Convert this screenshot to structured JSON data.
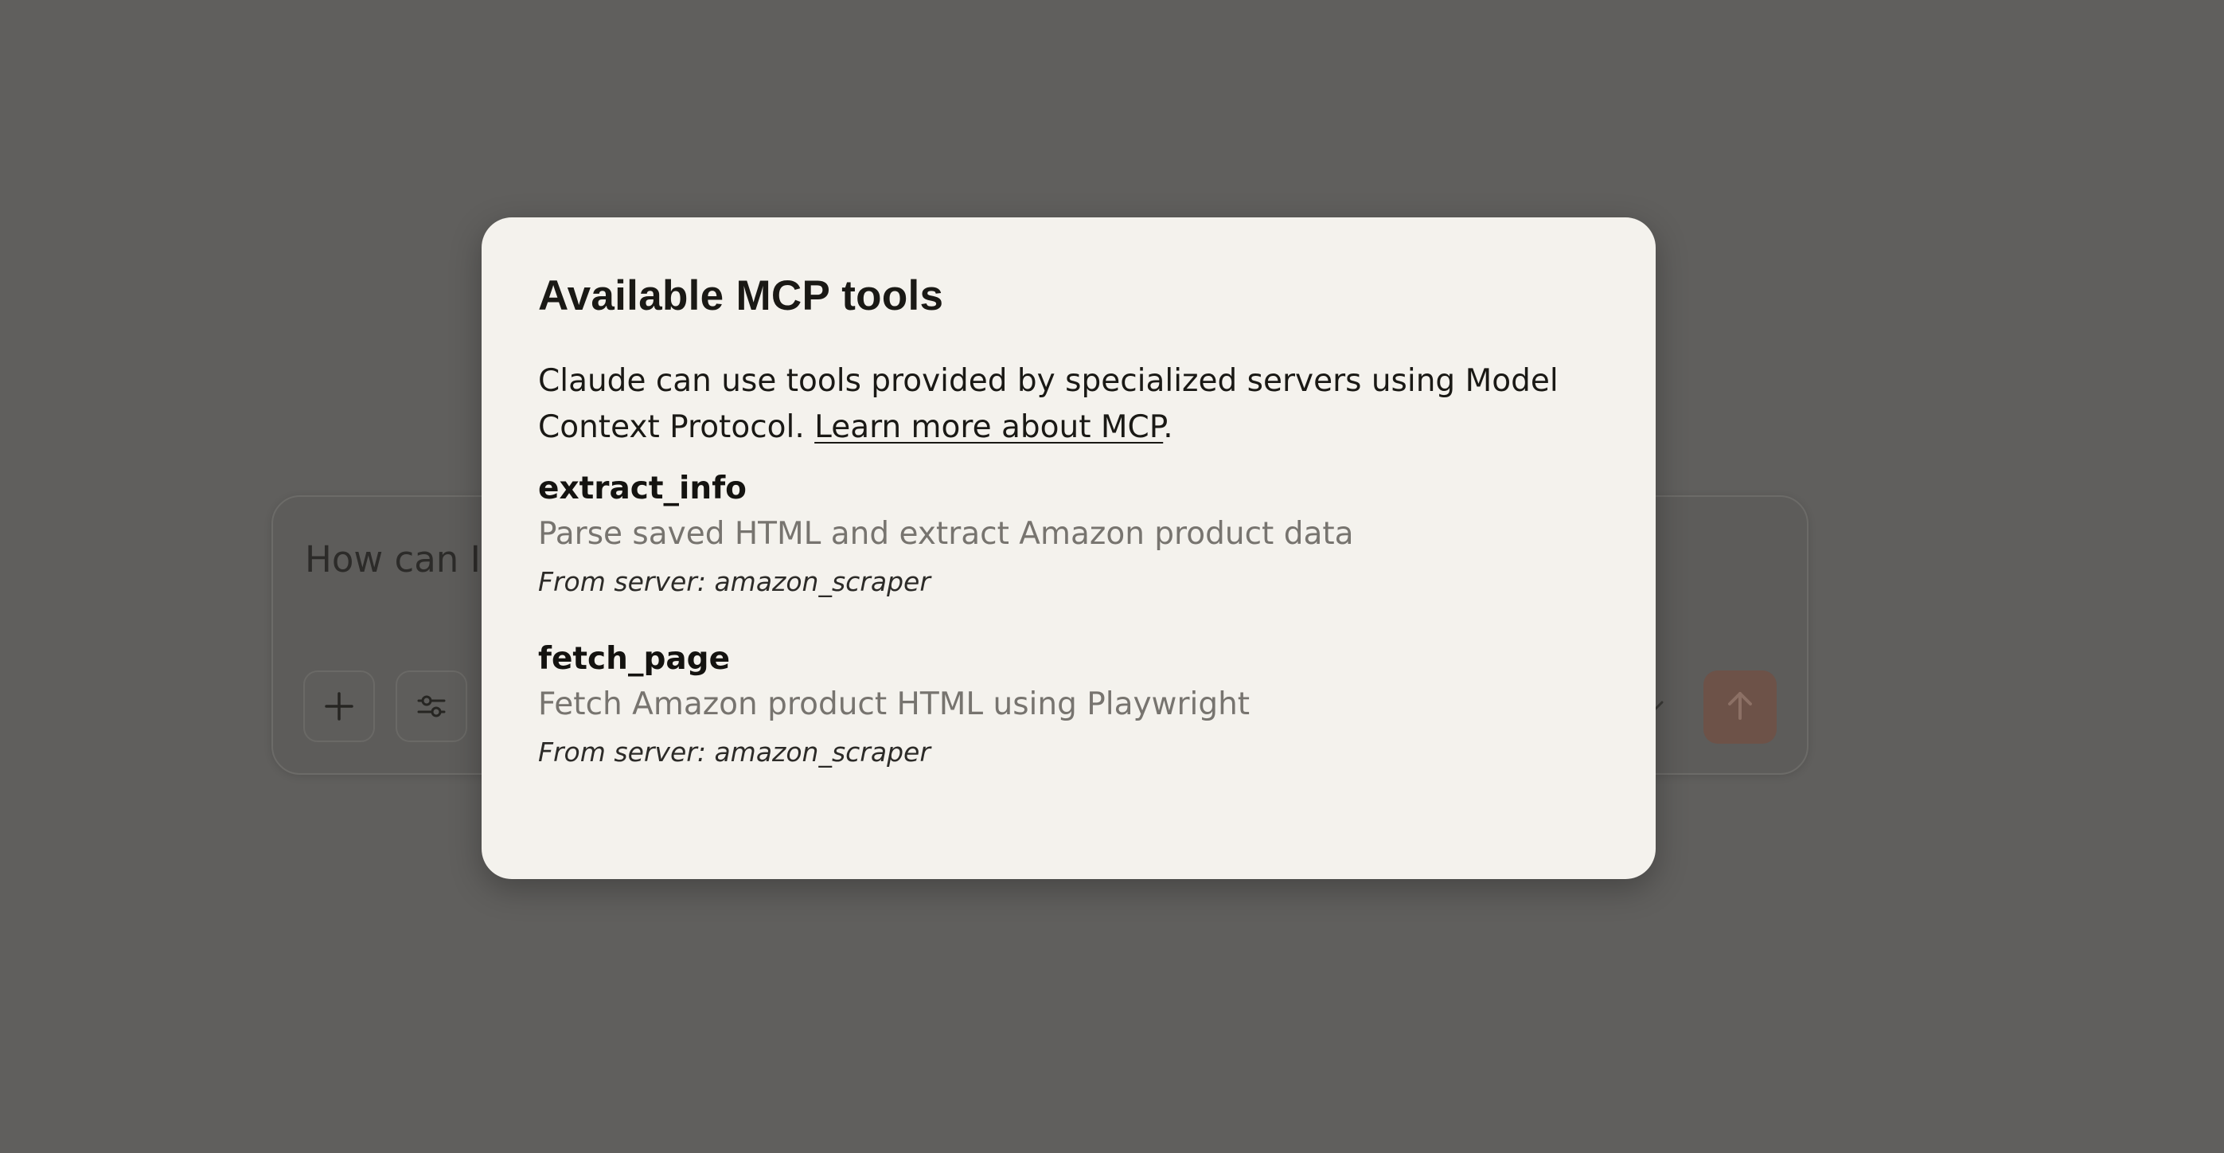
{
  "composer": {
    "placeholder": "How can I",
    "add_icon": "plus-icon",
    "tools_icon": "sliders-icon",
    "model_icon": "chevron-down-icon",
    "send_icon": "arrow-up-icon"
  },
  "modal": {
    "title": "Available MCP tools",
    "description": "Claude can use tools provided by specialized servers using Model Context Protocol.",
    "link_text": "Learn more about MCP",
    "link_suffix": ".",
    "tools": [
      {
        "name": "extract_info",
        "description": "Parse saved HTML and extract Amazon product data",
        "server": "From server: amazon_scraper"
      },
      {
        "name": "fetch_page",
        "description": "Fetch Amazon product HTML using Playwright",
        "server": "From server: amazon_scraper"
      }
    ]
  },
  "colors": {
    "overlay": "#605f5d",
    "modal_bg": "#f4f2ed",
    "send_button": "#6d5248"
  }
}
